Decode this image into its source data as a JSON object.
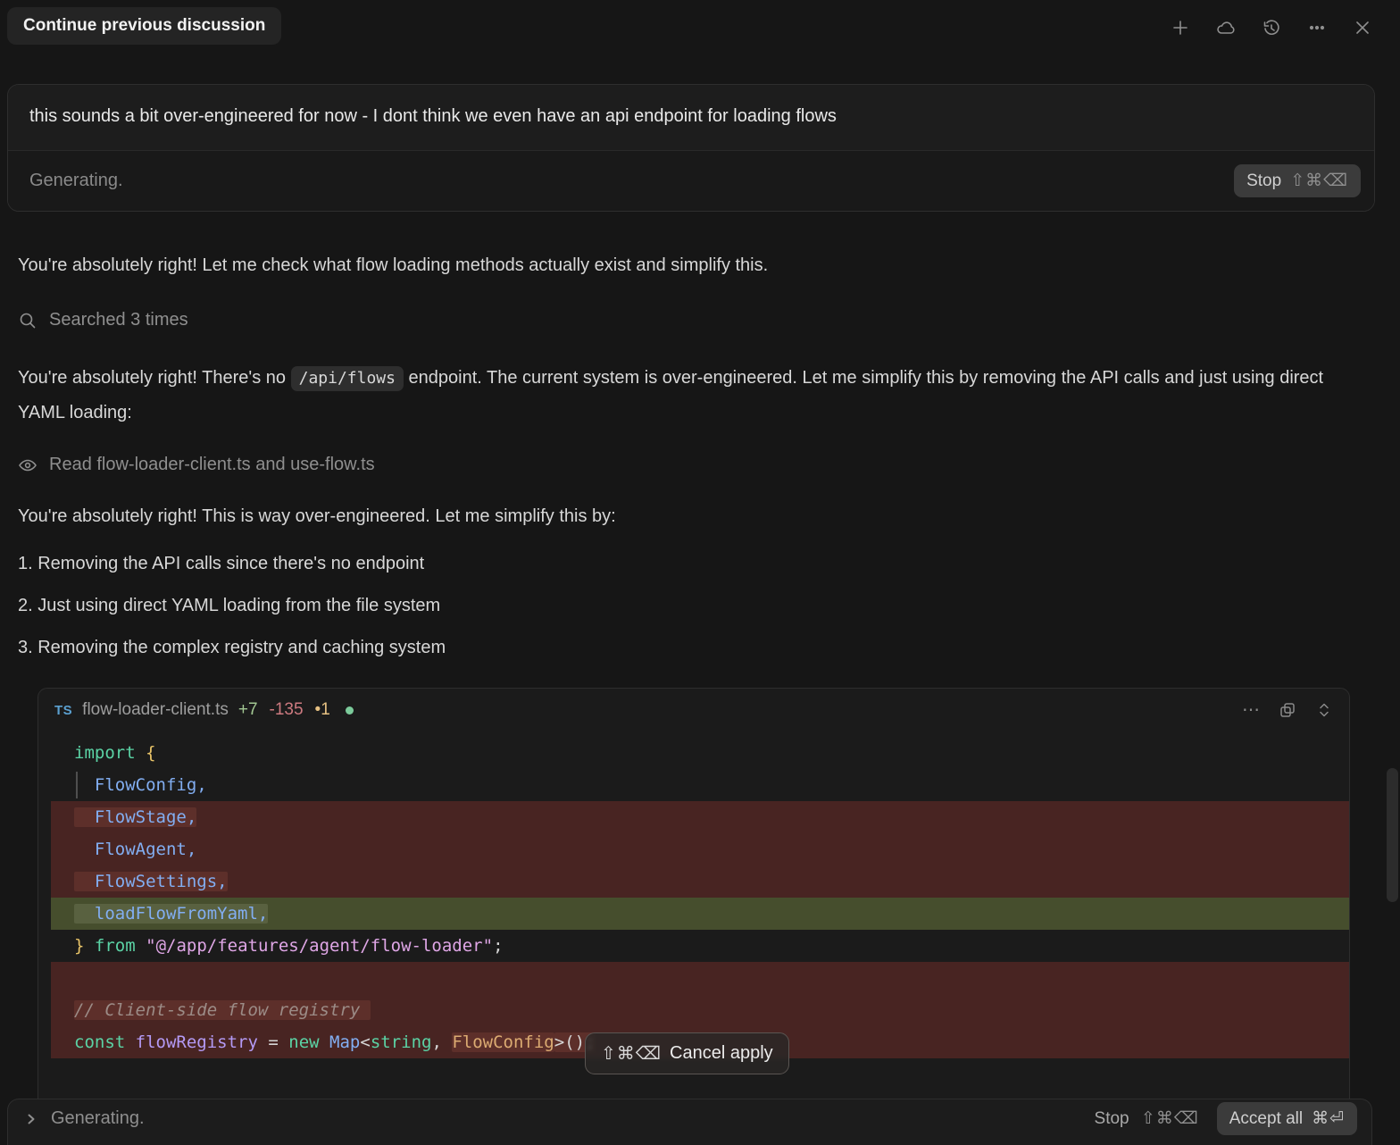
{
  "header": {
    "tab_label": "Continue previous discussion"
  },
  "composer": {
    "message": "this sounds a bit over-engineered for now - I dont think we even have an api endpoint for loading flows",
    "status": "Generating.",
    "stop_label": "Stop",
    "stop_shortcut": "⇧⌘⌫"
  },
  "chat": {
    "p1": "You're absolutely right! Let me check what flow loading methods actually exist and simplify this.",
    "searched": "Searched 3 times",
    "p2_before": "You're absolutely right! There's no ",
    "p2_code": "/api/flows",
    "p2_after": " endpoint. The current system is over-engineered. Let me simplify this by removing the API calls and just using direct YAML loading:",
    "read": "Read flow-loader-client.ts and use-flow.ts",
    "p3": "You're absolutely right! This is way over-engineered. Let me simplify this by:",
    "list": [
      "1. Removing the API calls since there's no endpoint",
      "2. Just using direct YAML loading from the file system",
      "3. Removing the complex registry and caching system"
    ]
  },
  "code_block": {
    "lang_badge": "TS",
    "filename": "flow-loader-client.ts",
    "additions": "+7",
    "deletions": "-135",
    "pending": "•1",
    "header_more": "⋯",
    "lines": [
      {
        "type": "normal",
        "tokens": [
          {
            "c": "kw",
            "t": "import"
          },
          {
            "c": "punct",
            "t": " "
          },
          {
            "c": "brace",
            "t": "{"
          }
        ]
      },
      {
        "type": "normal",
        "guide": true,
        "tokens": [
          {
            "c": "ident",
            "t": "  FlowConfig,"
          }
        ]
      },
      {
        "type": "del",
        "tokens": [
          {
            "c": "ident",
            "t": "  FlowStage,",
            "hl": true
          }
        ]
      },
      {
        "type": "del",
        "tokens": [
          {
            "c": "ident",
            "t": "  FlowAgent,"
          }
        ]
      },
      {
        "type": "del",
        "tokens": [
          {
            "c": "ident",
            "t": "  FlowSettings,",
            "hl": true
          }
        ]
      },
      {
        "type": "add",
        "tokens": [
          {
            "c": "ident",
            "t": "  loadFlowFromYaml,",
            "hl": true
          }
        ]
      },
      {
        "type": "normal",
        "tokens": [
          {
            "c": "brace",
            "t": "}"
          },
          {
            "c": "punct",
            "t": " "
          },
          {
            "c": "kw",
            "t": "from"
          },
          {
            "c": "punct",
            "t": " "
          },
          {
            "c": "str",
            "t": "\"@/app/features/agent/flow-loader\""
          },
          {
            "c": "punct",
            "t": ";"
          }
        ]
      },
      {
        "type": "del",
        "tokens": []
      },
      {
        "type": "del",
        "tokens": [
          {
            "c": "comment",
            "t": "// Client-side flow registry ",
            "hl": true
          }
        ]
      },
      {
        "type": "del",
        "tokens": [
          {
            "c": "kw",
            "t": "const"
          },
          {
            "c": "punct",
            "t": " "
          },
          {
            "c": "var",
            "t": "flowRegistry"
          },
          {
            "c": "punct",
            "t": " = "
          },
          {
            "c": "kw",
            "t": "new"
          },
          {
            "c": "punct",
            "t": " "
          },
          {
            "c": "ident",
            "t": "Map"
          },
          {
            "c": "punct",
            "t": "<"
          },
          {
            "c": "kw",
            "t": "string"
          },
          {
            "c": "punct",
            "t": ", "
          },
          {
            "c": "typ",
            "t": "FlowConfig",
            "hl": true
          },
          {
            "c": "punct",
            "t": ">();",
            "hl": true
          }
        ]
      }
    ]
  },
  "overlay": {
    "cancel_shortcut": "⇧⌘⌫",
    "cancel_label": "Cancel apply"
  },
  "footer": {
    "status": "Generating.",
    "stop_label": "Stop",
    "stop_shortcut": "⇧⌘⌫",
    "accept_label": "Accept all",
    "accept_shortcut": "⌘⏎"
  },
  "colors": {
    "addition": "#a3c893",
    "deletion": "#cd7a80",
    "pending": "#e6c183",
    "diff_del_bg": "#482422",
    "diff_add_bg": "#464e2d",
    "ts_badge": "#5ba0d0"
  },
  "icons": [
    "new-chat-icon",
    "cloud-icon",
    "history-icon",
    "more-icon",
    "close-icon",
    "search-icon",
    "eye-icon",
    "copy-icon",
    "expand-icon",
    "chevron-right-icon",
    "unsaved-dot"
  ]
}
